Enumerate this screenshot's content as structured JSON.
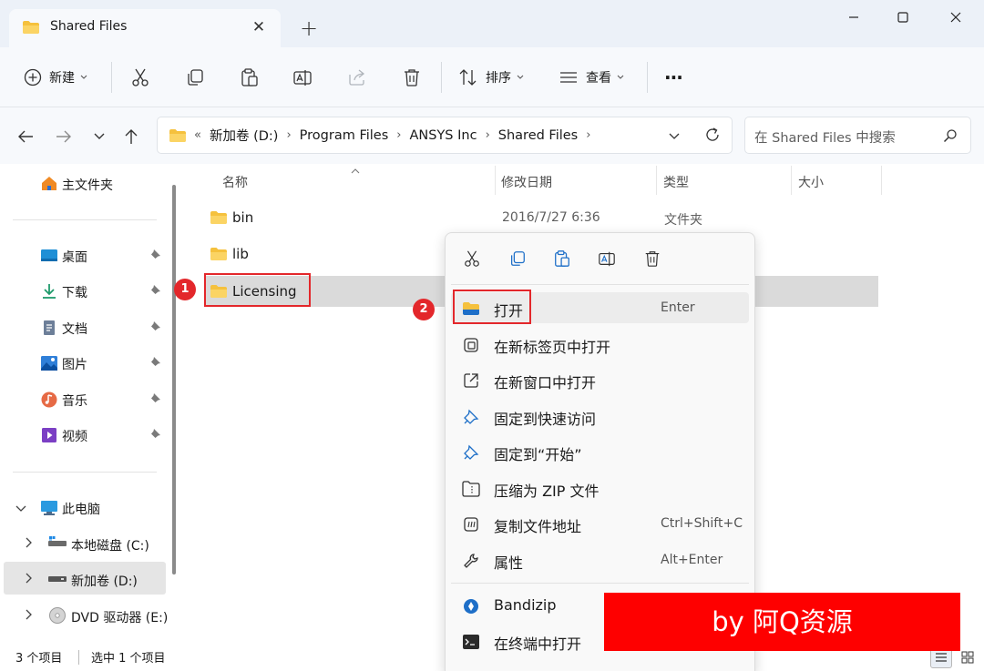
{
  "window": {
    "tab_title": "Shared Files",
    "new_tab": "+"
  },
  "toolbar": {
    "new_label": "新建",
    "sort_label": "排序",
    "view_label": "查看",
    "more": "···"
  },
  "address": {
    "crumbs": [
      "新加卷 (D:)",
      "Program Files",
      "ANSYS Inc",
      "Shared Files"
    ],
    "chevron": "«",
    "search_placeholder": "在 Shared Files 中搜索"
  },
  "sidebar": {
    "home": "主文件夹",
    "quick": [
      {
        "label": "桌面",
        "icon": "desktop-icon"
      },
      {
        "label": "下载",
        "icon": "download-icon"
      },
      {
        "label": "文档",
        "icon": "documents-icon"
      },
      {
        "label": "图片",
        "icon": "pictures-icon"
      },
      {
        "label": "音乐",
        "icon": "music-icon"
      },
      {
        "label": "视频",
        "icon": "videos-icon"
      }
    ],
    "this_pc": "此电脑",
    "drives": [
      "本地磁盘 (C:)",
      "新加卷 (D:)",
      "DVD 驱动器 (E:)"
    ]
  },
  "columns": {
    "name": "名称",
    "modified": "修改日期",
    "type": "类型",
    "size": "大小"
  },
  "files": [
    {
      "name": "bin",
      "modified": "2016/7/27 6:36",
      "type": "文件夹"
    },
    {
      "name": "lib",
      "modified": "",
      "type": ""
    },
    {
      "name": "Licensing",
      "modified": "",
      "type": ""
    }
  ],
  "annotations": {
    "step1": "1",
    "step2": "2"
  },
  "context_menu": {
    "items": [
      {
        "label": "打开",
        "shortcut": "Enter",
        "icon": "folder-open-icon"
      },
      {
        "label": "在新标签页中打开",
        "shortcut": "",
        "icon": "new-tab-icon"
      },
      {
        "label": "在新窗口中打开",
        "shortcut": "",
        "icon": "new-window-icon"
      },
      {
        "label": "固定到快速访问",
        "shortcut": "",
        "icon": "pin-icon"
      },
      {
        "label": "固定到“开始”",
        "shortcut": "",
        "icon": "pin-start-icon"
      },
      {
        "label": "压缩为 ZIP 文件",
        "shortcut": "",
        "icon": "zip-icon"
      },
      {
        "label": "复制文件地址",
        "shortcut": "Ctrl+Shift+C",
        "icon": "copy-path-icon"
      },
      {
        "label": "属性",
        "shortcut": "Alt+Enter",
        "icon": "wrench-icon"
      },
      {
        "label": "Bandizip",
        "shortcut": "",
        "icon": "bandizip-icon"
      },
      {
        "label": "在终端中打开",
        "shortcut": "",
        "icon": "terminal-icon"
      }
    ]
  },
  "status": {
    "count": "3 个项目",
    "selected": "选中 1 个项目"
  },
  "watermark": "by 阿Q资源",
  "colors": {
    "accent": "#005fb8",
    "annotation_red": "#e3272b",
    "watermark_red": "#fe0000",
    "folder_yellow": "#f5c13d"
  }
}
